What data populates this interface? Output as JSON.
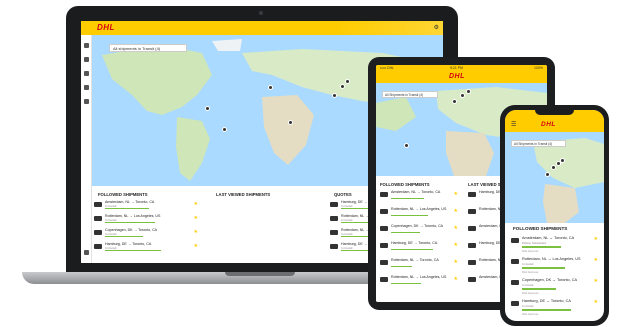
{
  "brand": {
    "logo_text": "DHL",
    "accent": "#ffcc00",
    "red": "#d40511",
    "progress_color": "#7ac142"
  },
  "laptop": {
    "shipment_filter": "All shipments in Transit (4)",
    "sections": {
      "followed": "FOLLOWED SHIPMENTS",
      "last_viewed": "LAST VIEWED SHIPMENTS",
      "quotes": "QUOTES"
    },
    "followed_rows": [
      {
        "route": "Amsterdam, NL → Toronto, CA",
        "sub": "In transit",
        "progress": 0.55
      },
      {
        "route": "Rotterdam, NL → Los Angeles, US",
        "sub": "In transit",
        "progress": 0.62
      },
      {
        "route": "Copenhagen, DK → Toronto, CA",
        "sub": "In transit",
        "progress": 0.48
      },
      {
        "route": "Hamburg, DE → Toronto, CA",
        "sub": "In transit",
        "progress": 0.7
      }
    ],
    "last_viewed_rows": [
      {
        "route": "Hamburg, DE → Toronto, CA",
        "sub": "In transit",
        "progress": 0.6
      },
      {
        "route": "Rotterdam, NL → Toronto, CA",
        "sub": "In transit",
        "progress": 0.5
      },
      {
        "route": "Rotterdam, NL → Los Angeles, US",
        "sub": "In transit",
        "progress": 0.66
      },
      {
        "route": "Hamburg, DE → Toronto, CA",
        "sub": "In transit",
        "progress": 0.4
      }
    ],
    "quote_rows": [
      {
        "route": "Houston, US"
      },
      {
        "route": "Rotterdam, NL"
      },
      {
        "route": "Hamburg, DE"
      },
      {
        "route": "Rotterdam, NL"
      },
      {
        "route": "Amsterdam, NL"
      }
    ]
  },
  "tablet": {
    "status": {
      "left": "••••• DHL",
      "center": "9:21 PM",
      "right": "100%"
    },
    "shipment_filter": "All Shipments in Transit (4)",
    "sections": {
      "followed": "FOLLOWED SHIPMENTS",
      "last_viewed": "LAST VIEWED SHIPMENTS"
    },
    "followed_rows": [
      {
        "route": "Amsterdam, NL → Toronto, CA",
        "progress": 0.55
      },
      {
        "route": "Rotterdam, NL → Los Angeles, US",
        "progress": 0.62
      },
      {
        "route": "Copenhagen, DK → Toronto, CA",
        "progress": 0.48
      },
      {
        "route": "Hamburg, DE → Toronto, CA",
        "progress": 0.7
      },
      {
        "route": "Rotterdam, NL → Toronto, CA",
        "progress": 0.35
      },
      {
        "route": "Rotterdam, NL → Los Angeles, US",
        "progress": 0.5
      }
    ],
    "last_viewed_rows": [
      {
        "route": "Hamburg, DE"
      },
      {
        "route": "Rotterdam, NL"
      },
      {
        "route": "Amsterdam, NL"
      },
      {
        "route": "Hamburg, DE"
      },
      {
        "route": "Rotterdam, NL"
      },
      {
        "route": "Amsterdam, NL"
      }
    ]
  },
  "phone": {
    "shipment_filter": "All Shipments in Transit (4)",
    "section_title": "FOLLOWED SHIPMENTS",
    "rows": [
      {
        "route": "Amsterdam, NL → Toronto, CA",
        "sub": "Pickup Scheduled",
        "meta": "DHL Express",
        "progress": 0.55
      },
      {
        "route": "Rotterdam, NL → Los Angeles, US",
        "sub": "In transit",
        "meta": "DHL Express",
        "progress": 0.62
      },
      {
        "route": "Copenhagen, DK → Toronto, CA",
        "sub": "In transit",
        "meta": "DHL Express",
        "progress": 0.48
      },
      {
        "route": "Hamburg, DE → Toronto, CA",
        "sub": "In transit",
        "meta": "DHL Express",
        "progress": 0.7
      }
    ]
  }
}
